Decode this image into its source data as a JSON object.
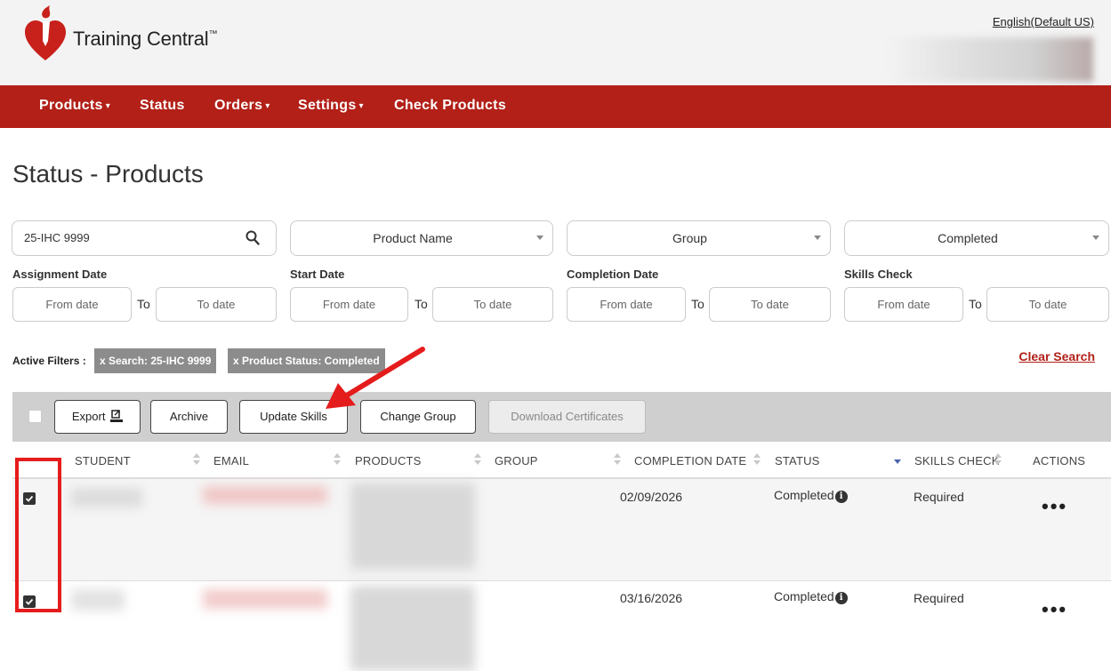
{
  "header": {
    "brand": "Training Central",
    "trademark": "™",
    "language_link": "English(Default US)"
  },
  "nav": {
    "products": "Products",
    "status": "Status",
    "orders": "Orders",
    "settings": "Settings",
    "check_products": "Check Products"
  },
  "page": {
    "title": "Status - Products"
  },
  "filters": {
    "search_value": "25-IHC 9999",
    "product_select": "Product Name",
    "group_select": "Group",
    "status_select": "Completed",
    "assignment_label": "Assignment Date",
    "start_label": "Start Date",
    "completion_label": "Completion Date",
    "skills_label": "Skills Check",
    "from_placeholder": "From date",
    "to_placeholder": "To date",
    "to_label": "To"
  },
  "active_filters": {
    "label": "Active Filters :",
    "chips": [
      "x Search: 25-IHC 9999",
      "x Product Status: Completed"
    ],
    "clear": "Clear Search"
  },
  "toolbar": {
    "export": "Export",
    "archive": "Archive",
    "update_skills": "Update Skills",
    "change_group": "Change Group",
    "download_certificates": "Download Certificates"
  },
  "table": {
    "columns": [
      "STUDENT",
      "EMAIL",
      "PRODUCTS",
      "GROUP",
      "COMPLETION DATE",
      "STATUS",
      "SKILLS CHECK",
      "ACTIONS"
    ],
    "rows": [
      {
        "completion_date": "02/09/2026",
        "status": "Completed",
        "skills_check": "Required",
        "actions": "•••",
        "checked": true
      },
      {
        "completion_date": "03/16/2026",
        "status": "Completed",
        "skills_check": "Required",
        "actions": "•••",
        "checked": true
      }
    ]
  },
  "colors": {
    "nav_red": "#b22018",
    "annotation_red": "#e51c1c",
    "chip_gray": "#8c8c8c",
    "toolbar_gray": "#cfcfcf"
  },
  "icons": {
    "search": "search-icon",
    "export": "export-icon",
    "info": "info-icon",
    "sort": "sort-icon",
    "checkbox": "checkbox-checked-icon"
  }
}
